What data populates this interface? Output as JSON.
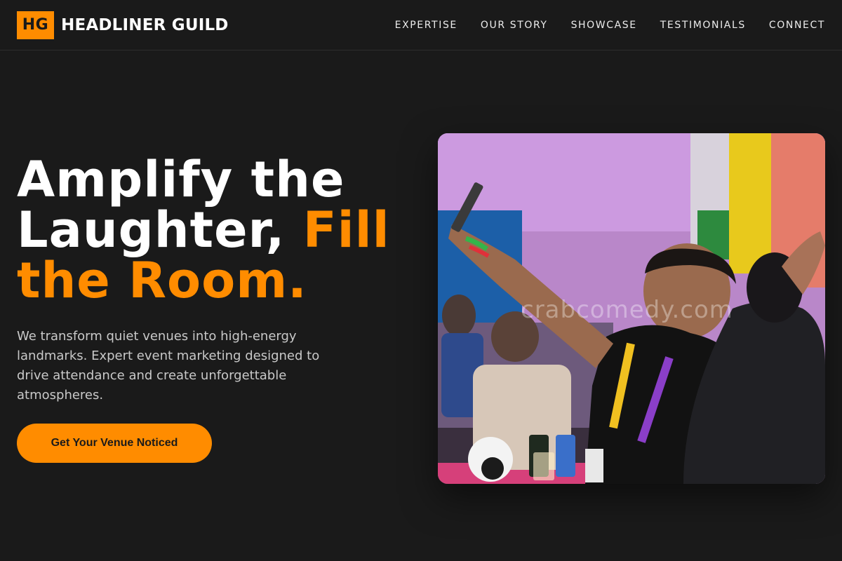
{
  "brand": {
    "mark": "HG",
    "name": "HEADLINER GUILD",
    "accent_color": "#ff8c00"
  },
  "nav": {
    "items": [
      "EXPERTISE",
      "OUR STORY",
      "SHOWCASE",
      "TESTIMONIALS",
      "CONNECT"
    ]
  },
  "hero": {
    "headline_line1": "Amplify the",
    "headline_line2_white": "Laughter,",
    "headline_line2_accent": "Fill",
    "headline_line3_accent": "the Room.",
    "subtext": "We transform quiet venues into high-energy landmarks. Expert event marketing designed to drive attendance and create unforgettable atmospheres.",
    "cta_label": "Get Your Venue Noticed",
    "image_watermark": "crabcomedy.com"
  }
}
